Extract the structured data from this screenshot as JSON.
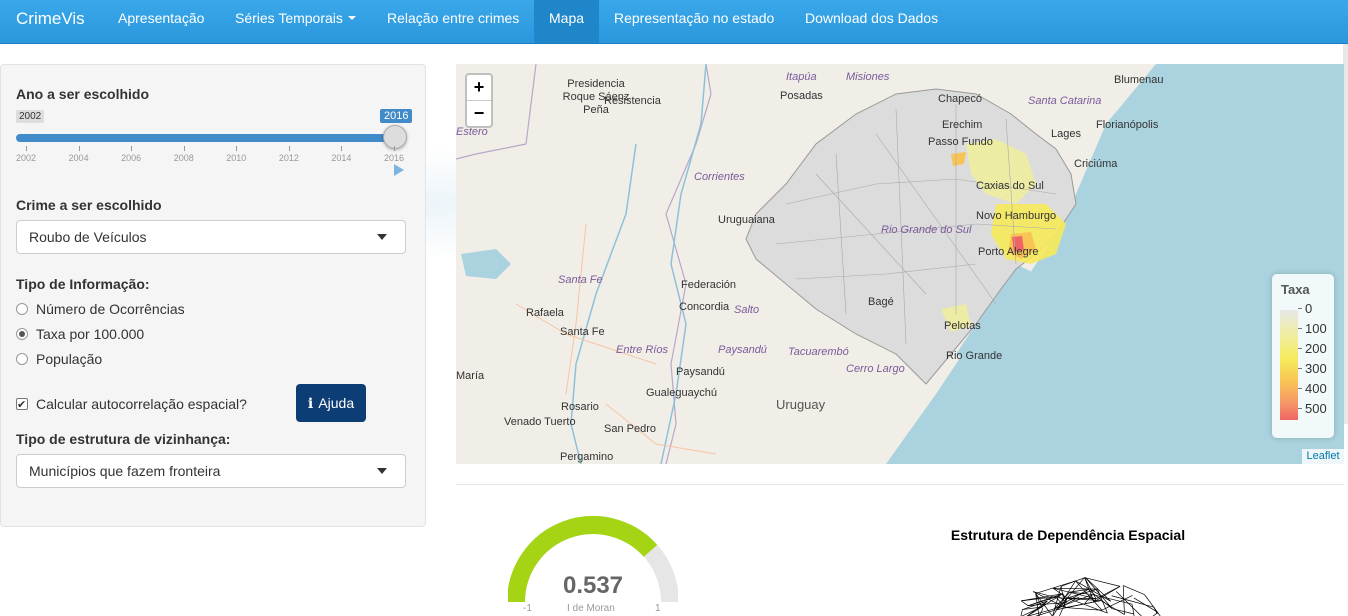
{
  "navbar": {
    "brand": "CrimeVis",
    "items": [
      {
        "label": "Apresentação"
      },
      {
        "label": "Séries Temporais"
      },
      {
        "label": "Relação entre crimes"
      },
      {
        "label": "Mapa"
      },
      {
        "label": "Representação no estado"
      },
      {
        "label": "Download dos Dados"
      }
    ],
    "active": "Mapa"
  },
  "sidebar": {
    "year_label": "Ano a ser escolhido",
    "year_min": "2002",
    "year_max": "2016",
    "year_selected": "2016",
    "year_ticks": [
      "2002",
      "2004",
      "2006",
      "2008",
      "2010",
      "2012",
      "2014",
      "2016"
    ],
    "crime_label": "Crime a ser escolhido",
    "crime_value": "Roubo de Veículos",
    "info_label": "Tipo de Informação:",
    "info_options": [
      "Número de Ocorrências",
      "Taxa por 100.000",
      "População"
    ],
    "info_selected": "Taxa por 100.000",
    "autocorr_label": "Calcular autocorrelação espacial?",
    "autocorr_checked": true,
    "help_button": "Ajuda",
    "neighborhood_label": "Tipo de estrutura de vizinhança:",
    "neighborhood_value": "Municípios que fazem fronteira"
  },
  "map": {
    "zoom_in": "+",
    "zoom_out": "−",
    "attribution": "Leaflet",
    "places": [
      "Presidencia Roque Sáenz Peña",
      "Resistencia",
      "Itapúa",
      "Misiones",
      "Posadas",
      "Chapecó",
      "Blumenau",
      "Santa Catarina",
      "Erechim",
      "Passo Fundo",
      "Lages",
      "Florianópolis",
      "Criciúma",
      "Caxias do Sul",
      "Novo Hamburgo",
      "Porto Alegre",
      "Corrientes",
      "Uruguaiana",
      "Rio Grande do Sul",
      "Santa Fe",
      "Federación",
      "Concordia",
      "Salto",
      "Rafaela",
      "Santa Fe",
      "Bagé",
      "Pelotas",
      "Entre Ríos",
      "Paysandú",
      "Tacuarembó",
      "Cerro Largo",
      "Rio Grande",
      "Paysandú",
      "Gualeguaychú",
      "Uruguay",
      "Rosario",
      "Venado Tuerto",
      "San Pedro",
      "Pergamino",
      "María",
      "Estero"
    ],
    "legend": {
      "title": "Taxa",
      "labels": [
        "0",
        "100",
        "200",
        "300",
        "400",
        "500"
      ],
      "colors": [
        "#e7e7e7",
        "#f0ee9a",
        "#f6ea5a",
        "#f8c456",
        "#f69567",
        "#ef6565"
      ]
    }
  },
  "gauge": {
    "value": "0.537",
    "value_number": 0.537,
    "min": "-1",
    "max": "1",
    "label": "I de Moran",
    "color": "#a4d414"
  },
  "network": {
    "title": "Estrutura de Dependência Espacial"
  }
}
